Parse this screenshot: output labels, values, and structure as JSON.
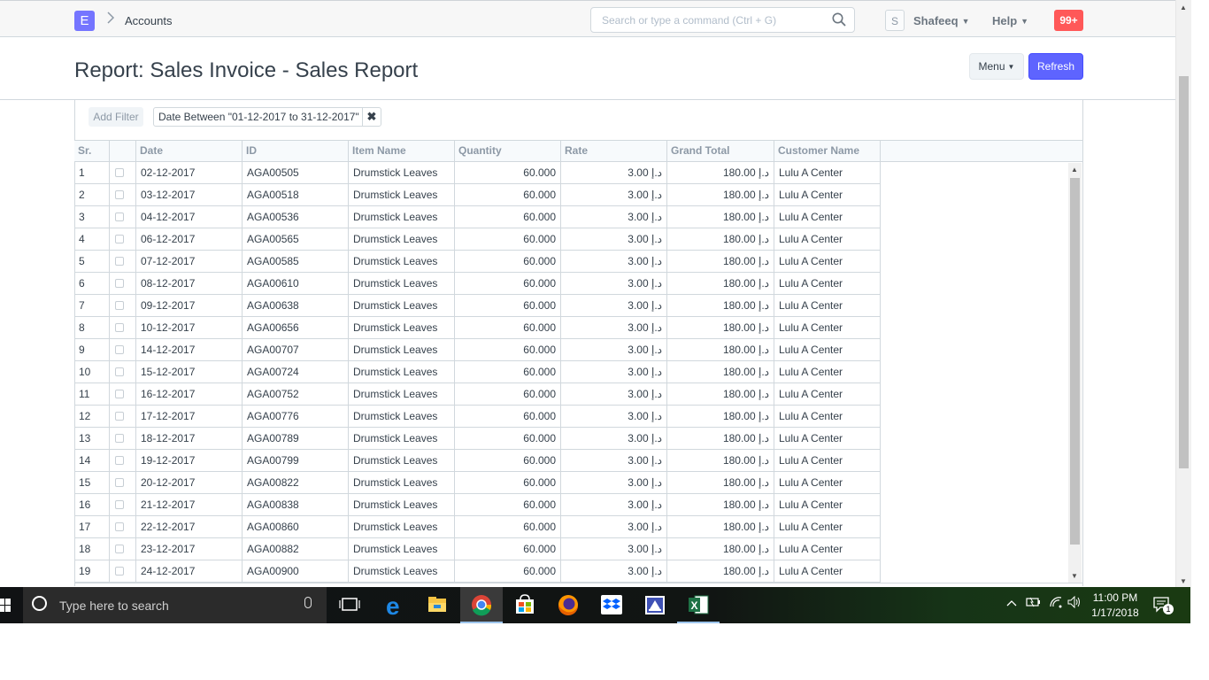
{
  "navbar": {
    "logo_letter": "E",
    "breadcrumb": "Accounts",
    "search_placeholder": "Search or type a command (Ctrl + G)",
    "avatar_initial": "S",
    "user_name": "Shafeeq",
    "help_label": "Help",
    "notification_count": "99+"
  },
  "page": {
    "title": "Report: Sales Invoice - Sales Report",
    "menu_label": "Menu",
    "refresh_label": "Refresh"
  },
  "filters": {
    "add_filter_label": "Add Filter",
    "active_filter": "Date Between \"01-12-2017 to 31-12-2017\"",
    "remove_symbol": "✖"
  },
  "table": {
    "columns": [
      "Sr.",
      "",
      "Date",
      "ID",
      "Item Name",
      "Quantity",
      "Rate",
      "Grand Total",
      "Customer Name"
    ],
    "rows": [
      {
        "sr": "1",
        "date": "02-12-2017",
        "id": "AGA00505",
        "item": "Drumstick Leaves",
        "qty": "60.000",
        "rate": "3.00 د.إ",
        "total": "180.00 د.إ",
        "customer": "Lulu A Center"
      },
      {
        "sr": "2",
        "date": "03-12-2017",
        "id": "AGA00518",
        "item": "Drumstick Leaves",
        "qty": "60.000",
        "rate": "3.00 د.إ",
        "total": "180.00 د.إ",
        "customer": "Lulu A Center"
      },
      {
        "sr": "3",
        "date": "04-12-2017",
        "id": "AGA00536",
        "item": "Drumstick Leaves",
        "qty": "60.000",
        "rate": "3.00 د.إ",
        "total": "180.00 د.إ",
        "customer": "Lulu A Center"
      },
      {
        "sr": "4",
        "date": "06-12-2017",
        "id": "AGA00565",
        "item": "Drumstick Leaves",
        "qty": "60.000",
        "rate": "3.00 د.إ",
        "total": "180.00 د.إ",
        "customer": "Lulu A Center"
      },
      {
        "sr": "5",
        "date": "07-12-2017",
        "id": "AGA00585",
        "item": "Drumstick Leaves",
        "qty": "60.000",
        "rate": "3.00 د.إ",
        "total": "180.00 د.إ",
        "customer": "Lulu A Center"
      },
      {
        "sr": "6",
        "date": "08-12-2017",
        "id": "AGA00610",
        "item": "Drumstick Leaves",
        "qty": "60.000",
        "rate": "3.00 د.إ",
        "total": "180.00 د.إ",
        "customer": "Lulu A Center"
      },
      {
        "sr": "7",
        "date": "09-12-2017",
        "id": "AGA00638",
        "item": "Drumstick Leaves",
        "qty": "60.000",
        "rate": "3.00 د.إ",
        "total": "180.00 د.إ",
        "customer": "Lulu A Center"
      },
      {
        "sr": "8",
        "date": "10-12-2017",
        "id": "AGA00656",
        "item": "Drumstick Leaves",
        "qty": "60.000",
        "rate": "3.00 د.إ",
        "total": "180.00 د.إ",
        "customer": "Lulu A Center"
      },
      {
        "sr": "9",
        "date": "14-12-2017",
        "id": "AGA00707",
        "item": "Drumstick Leaves",
        "qty": "60.000",
        "rate": "3.00 د.إ",
        "total": "180.00 د.إ",
        "customer": "Lulu A Center"
      },
      {
        "sr": "10",
        "date": "15-12-2017",
        "id": "AGA00724",
        "item": "Drumstick Leaves",
        "qty": "60.000",
        "rate": "3.00 د.إ",
        "total": "180.00 د.إ",
        "customer": "Lulu A Center"
      },
      {
        "sr": "11",
        "date": "16-12-2017",
        "id": "AGA00752",
        "item": "Drumstick Leaves",
        "qty": "60.000",
        "rate": "3.00 د.إ",
        "total": "180.00 د.إ",
        "customer": "Lulu A Center"
      },
      {
        "sr": "12",
        "date": "17-12-2017",
        "id": "AGA00776",
        "item": "Drumstick Leaves",
        "qty": "60.000",
        "rate": "3.00 د.إ",
        "total": "180.00 د.إ",
        "customer": "Lulu A Center"
      },
      {
        "sr": "13",
        "date": "18-12-2017",
        "id": "AGA00789",
        "item": "Drumstick Leaves",
        "qty": "60.000",
        "rate": "3.00 د.إ",
        "total": "180.00 د.إ",
        "customer": "Lulu A Center"
      },
      {
        "sr": "14",
        "date": "19-12-2017",
        "id": "AGA00799",
        "item": "Drumstick Leaves",
        "qty": "60.000",
        "rate": "3.00 د.إ",
        "total": "180.00 د.إ",
        "customer": "Lulu A Center"
      },
      {
        "sr": "15",
        "date": "20-12-2017",
        "id": "AGA00822",
        "item": "Drumstick Leaves",
        "qty": "60.000",
        "rate": "3.00 د.إ",
        "total": "180.00 د.إ",
        "customer": "Lulu A Center"
      },
      {
        "sr": "16",
        "date": "21-12-2017",
        "id": "AGA00838",
        "item": "Drumstick Leaves",
        "qty": "60.000",
        "rate": "3.00 د.إ",
        "total": "180.00 د.إ",
        "customer": "Lulu A Center"
      },
      {
        "sr": "17",
        "date": "22-12-2017",
        "id": "AGA00860",
        "item": "Drumstick Leaves",
        "qty": "60.000",
        "rate": "3.00 د.إ",
        "total": "180.00 د.إ",
        "customer": "Lulu A Center"
      },
      {
        "sr": "18",
        "date": "23-12-2017",
        "id": "AGA00882",
        "item": "Drumstick Leaves",
        "qty": "60.000",
        "rate": "3.00 د.إ",
        "total": "180.00 د.إ",
        "customer": "Lulu A Center"
      },
      {
        "sr": "19",
        "date": "24-12-2017",
        "id": "AGA00900",
        "item": "Drumstick Leaves",
        "qty": "60.000",
        "rate": "3.00 د.إ",
        "total": "180.00 د.إ",
        "customer": "Lulu A Center"
      }
    ]
  },
  "taskbar": {
    "search_placeholder": "Type here to search",
    "pinned_icons": [
      "task-view-icon",
      "edge-icon",
      "file-explorer-icon",
      "chrome-icon",
      "store-icon",
      "firefox-icon",
      "dropbox-icon",
      "app-icon",
      "excel-icon"
    ],
    "time": "11:00 PM",
    "date": "1/17/2018",
    "notification_badge": "1"
  },
  "colors": {
    "brand": "#7575ff",
    "primary_button": "#5e64ff",
    "notification": "#ff5858",
    "text": "#36414c",
    "muted": "#8d99a6",
    "border": "#d1d8dd"
  }
}
